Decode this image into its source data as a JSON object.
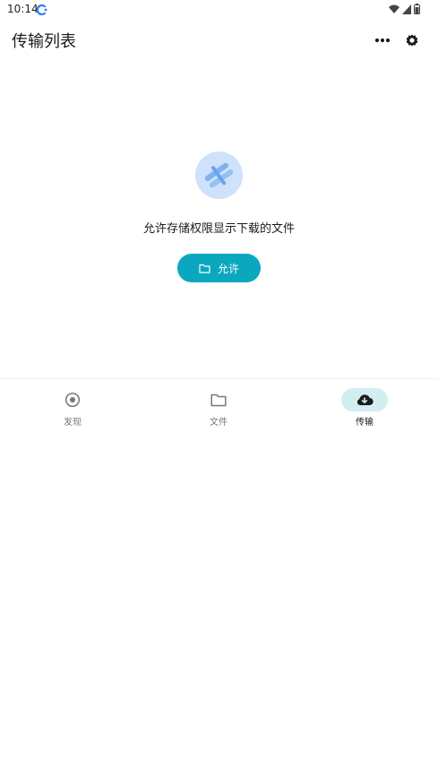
{
  "status_bar": {
    "time": "10:14",
    "app_icon": "c-logo-icon",
    "indicators": [
      "wifi-icon",
      "signal-icon",
      "battery-icon"
    ]
  },
  "header": {
    "title": "传输列表",
    "actions": [
      "more-icon",
      "gear-icon"
    ]
  },
  "empty_state": {
    "illustration": "transfer-icon",
    "message": "允许存储权限显示下载的文件",
    "button_label": "允许",
    "button_icon": "folder-icon"
  },
  "bottom_nav": {
    "active": "传输",
    "items": [
      {
        "label": "发现",
        "icon": "target-icon"
      },
      {
        "label": "文件",
        "icon": "folder-icon"
      },
      {
        "label": "传输",
        "icon": "cloud-download-icon"
      }
    ]
  },
  "colors": {
    "accent": "#0aa8bf",
    "active_tab_bg": "#d2eef0",
    "illustration_bg": "#cfe2fb"
  }
}
